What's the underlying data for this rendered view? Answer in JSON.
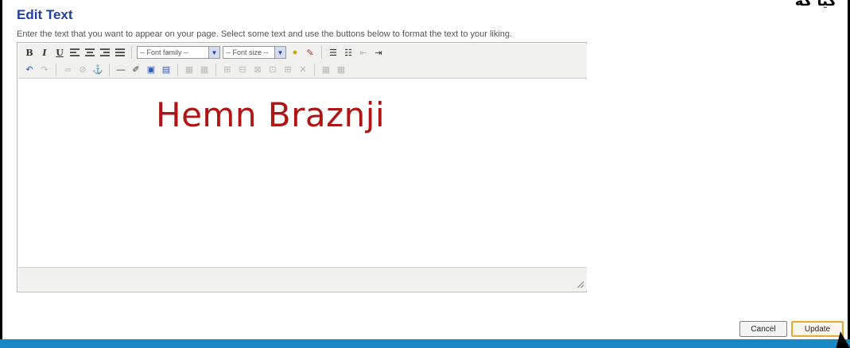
{
  "dialog": {
    "title": "Edit Text",
    "instructions": "Enter the text that you want to appear on your page. Select some text and use the buttons below to format the text to your liking.",
    "corner_mark": "ﮔﻴﺎ ﮔﻪ"
  },
  "toolbar": {
    "row1": {
      "bold_label": "B",
      "italic_label": "I",
      "underline_label": "U",
      "font_family_placeholder": "-- Font family --",
      "font_size_placeholder": "-- Font size --"
    }
  },
  "editor": {
    "content_text": "Hemn Braznji",
    "content_color": "#b01414"
  },
  "buttons": {
    "cancel_label": "Cancel",
    "update_label": "Update"
  },
  "colors": {
    "title": "#1e3fa6",
    "bottom_bar": "#1789c4",
    "update_border": "#e5a93a"
  },
  "icons": [
    "bold-icon",
    "italic-icon",
    "underline-icon",
    "align-left-icon",
    "align-center-icon",
    "align-right-icon",
    "align-justify-icon",
    "text-color-icon",
    "highlight-icon",
    "bulleted-list-icon",
    "numbered-list-icon",
    "outdent-icon",
    "indent-icon",
    "undo-icon",
    "redo-icon",
    "link-icon",
    "unlink-icon",
    "anchor-icon",
    "horizontal-rule-icon",
    "image-icon",
    "edit-image-icon",
    "code-icon",
    "table-icon",
    "cell-icon",
    "row-icon",
    "column-icon",
    "merge-icon",
    "split-icon",
    "delete-icon",
    "cleanup-icon"
  ]
}
